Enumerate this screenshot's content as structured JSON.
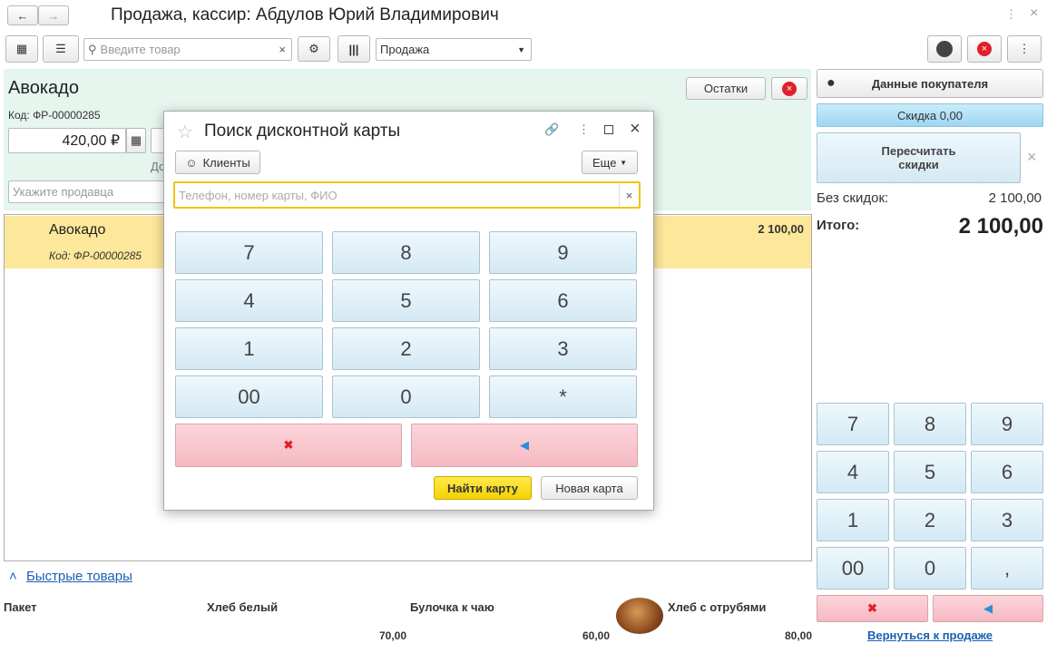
{
  "window": {
    "title": "Продажа, кассир: Абдулов Юрий Владимирович"
  },
  "toolbar": {
    "search_placeholder": "Введите товар",
    "mode_value": "Продажа"
  },
  "product": {
    "name": "Авокадо",
    "code_label": "Код:",
    "code": "ФР-00000285",
    "price": "420,00 ₽",
    "partial_label": "До",
    "seller_placeholder": "Укажите продавца",
    "stock_button": "Остатки"
  },
  "cart": {
    "rows": [
      {
        "name": "Авокадо",
        "code": "Код: ФР-00000285",
        "sum": "2 100,00"
      }
    ]
  },
  "quick": {
    "title": "Быстрые товары",
    "items": [
      {
        "name": "Пакет",
        "price": ""
      },
      {
        "name": "Хлеб белый",
        "price": "70,00"
      },
      {
        "name": "Булочка к чаю",
        "price": "60,00"
      },
      {
        "name": "Хлеб с отрубями",
        "price": "80,00"
      }
    ]
  },
  "right": {
    "customer_button": "Данные покупателя",
    "discount": "Скидка 0,00",
    "recalc_button": "Пересчитать скидки",
    "no_discount_label": "Без скидок:",
    "no_discount_value": "2 100,00",
    "total_label": "Итого:",
    "total_value": "2 100,00",
    "keys": [
      "7",
      "8",
      "9",
      "4",
      "5",
      "6",
      "1",
      "2",
      "3",
      "00",
      "0",
      ","
    ],
    "return_link": "Вернуться к продаже"
  },
  "modal": {
    "title": "Поиск дисконтной карты",
    "clients_button": "Клиенты",
    "more_button": "Еще",
    "search_placeholder": "Телефон, номер карты, ФИО",
    "keys": [
      "7",
      "8",
      "9",
      "4",
      "5",
      "6",
      "1",
      "2",
      "3",
      "00",
      "0",
      "*"
    ],
    "find_button": "Найти карту",
    "new_button": "Новая карта"
  },
  "colors": {
    "accent_yellow": "#f5d800",
    "selected_row": "#fde79a",
    "panel_green": "#e6f5ee",
    "link": "#1a5fb4"
  }
}
